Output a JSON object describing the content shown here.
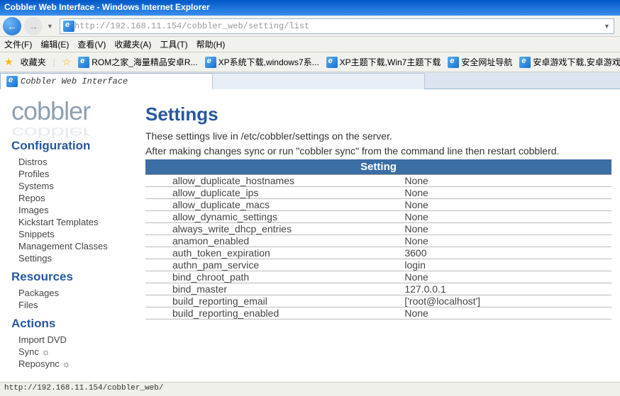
{
  "window": {
    "title": "Cobbler Web Interface - Windows Internet Explorer"
  },
  "url": {
    "text": "http://192.168.11.154/cobbler_web/setting/list"
  },
  "menus": {
    "file": "文件(F)",
    "edit": "编辑(E)",
    "view": "查看(V)",
    "favorites": "收藏夹(A)",
    "tools": "工具(T)",
    "help": "帮助(H)"
  },
  "favbar": {
    "label": "收藏夹",
    "items": [
      "ROM之家_海量精品安卓R...",
      "XP系统下载,windows7系...",
      "XP主题下载,Win7主题下载",
      "安全网址导航",
      "安卓游戏下载,安卓游戏..."
    ]
  },
  "tab": {
    "title": "Cobbler Web Interface"
  },
  "logo": "cobbler",
  "sidebar": {
    "config_head": "Configuration",
    "config_items": [
      "Distros",
      "Profiles",
      "Systems",
      "Repos",
      "Images",
      "Kickstart Templates",
      "Snippets",
      "Management Classes",
      "Settings"
    ],
    "resources_head": "Resources",
    "resources_items": [
      "Packages",
      "Files"
    ],
    "actions_head": "Actions",
    "actions_items": [
      "Import DVD",
      "Sync ☼",
      "Reposync ☼"
    ]
  },
  "main": {
    "title": "Settings",
    "desc1": "These settings live in /etc/cobbler/settings on the server.",
    "desc2": "After making changes sync or run \"cobbler sync\" from the command line then restart cobblerd.",
    "col_header": "Setting",
    "rows": [
      {
        "k": "allow_duplicate_hostnames",
        "v": "None"
      },
      {
        "k": "allow_duplicate_ips",
        "v": "None"
      },
      {
        "k": "allow_duplicate_macs",
        "v": "None"
      },
      {
        "k": "allow_dynamic_settings",
        "v": "None"
      },
      {
        "k": "always_write_dhcp_entries",
        "v": "None"
      },
      {
        "k": "anamon_enabled",
        "v": "None"
      },
      {
        "k": "auth_token_expiration",
        "v": "3600"
      },
      {
        "k": "authn_pam_service",
        "v": "login"
      },
      {
        "k": "bind_chroot_path",
        "v": "None"
      },
      {
        "k": "bind_master",
        "v": "127.0.0.1"
      },
      {
        "k": "build_reporting_email",
        "v": "['root@localhost']"
      },
      {
        "k": "build_reporting_enabled",
        "v": "None"
      }
    ]
  },
  "status": "http://192.168.11.154/cobbler_web/"
}
